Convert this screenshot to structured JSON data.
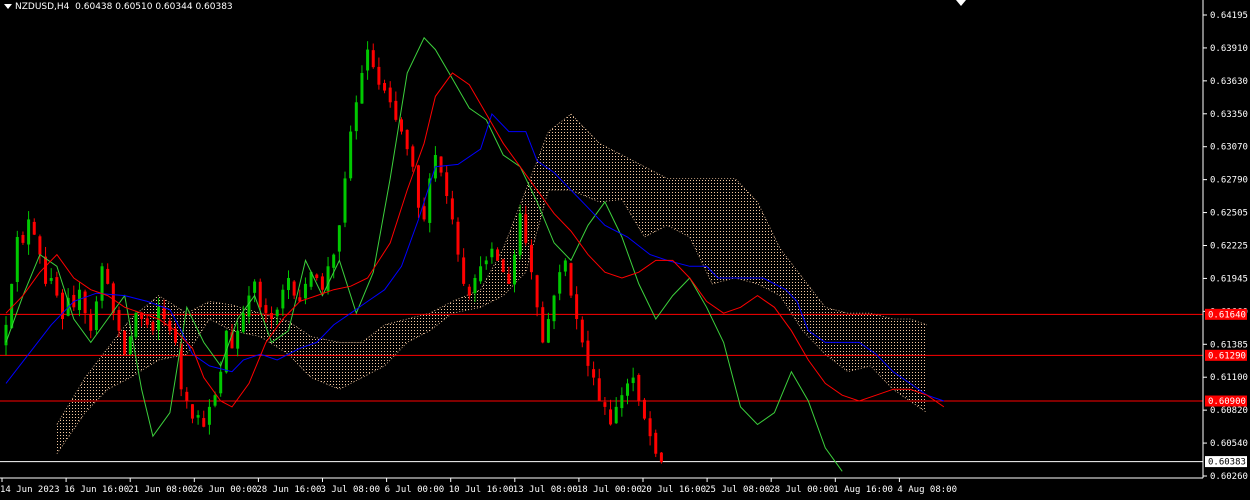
{
  "header": {
    "symbol_tf": "NZDUSD,H4",
    "open": "0.60438",
    "high": "0.60510",
    "low": "0.60344",
    "close": "0.60383"
  },
  "colors": {
    "background": "#000000",
    "bull": "#00c800",
    "bear": "#ff0000",
    "tenkan": "#ff0000",
    "kijun": "#0000ff",
    "chikou": "#3cd03c",
    "cloud": "#f4c8a0",
    "hline": "#ff0000",
    "axis": "#ffffff"
  },
  "chart_data": {
    "type": "candlestick",
    "indicator": "Ichimoku",
    "x_labels": [
      "14 Jun 2023",
      "16 Jun 16:00",
      "21 Jun 08:00",
      "26 Jun 00:00",
      "28 Jun 16:00",
      "3 Jul 08:00",
      "6 Jul 00:00",
      "10 Jul 16:00",
      "13 Jul 08:00",
      "18 Jul 00:00",
      "20 Jul 16:00",
      "25 Jul 08:00",
      "28 Jul 00:00",
      "1 Aug 16:00",
      "4 Aug 08:00"
    ],
    "y_ticks": [
      "0.64195",
      "0.63910",
      "0.63630",
      "0.63350",
      "0.63070",
      "0.62790",
      "0.62505",
      "0.62225",
      "0.61945",
      "0.61660",
      "0.61385",
      "0.61100",
      "0.60820",
      "0.60540",
      "0.60260"
    ],
    "ylim": [
      0.6026,
      0.64195
    ],
    "price_lines": [
      {
        "value": 0.6164,
        "label": "0.61640"
      },
      {
        "value": 0.6129,
        "label": "0.61290"
      },
      {
        "value": 0.609,
        "label": "0.60900"
      }
    ],
    "current_price": {
      "value": 0.60383,
      "label": "0.60383"
    },
    "close_path": [
      [
        0.6155,
        0.619,
        0.623,
        0.6225,
        0.6245,
        0.6232,
        0.6215,
        0.619
      ],
      [
        0.6195,
        0.618,
        0.616,
        0.6178,
        0.617,
        0.6185,
        0.6165,
        0.615
      ],
      [
        0.6175,
        0.6205,
        0.619,
        0.6165,
        0.615,
        0.613,
        0.6145,
        0.6165
      ],
      [
        0.616,
        0.6155,
        0.615,
        0.617,
        0.616,
        0.615,
        0.614,
        0.61
      ],
      [
        0.609,
        0.6075,
        0.6078,
        0.6068,
        0.6085,
        0.6095,
        0.6115,
        0.615
      ],
      [
        0.6135,
        0.615,
        0.6165,
        0.618,
        0.6192,
        0.617,
        0.6165,
        0.616
      ],
      [
        0.6168,
        0.6185,
        0.6195,
        0.618,
        0.6175,
        0.619,
        0.62,
        0.6195
      ],
      [
        0.6185,
        0.6205,
        0.6215,
        0.624,
        0.628,
        0.632,
        0.6345,
        0.637
      ],
      [
        0.639,
        0.6375,
        0.636,
        0.6355,
        0.6345,
        0.633,
        0.632,
        0.6305
      ],
      [
        0.629,
        0.6255,
        0.6245,
        0.628,
        0.63,
        0.6285,
        0.6265,
        0.6245
      ],
      [
        0.6215,
        0.619,
        0.618,
        0.6195,
        0.6205,
        0.621,
        0.622,
        0.621
      ],
      [
        0.62,
        0.619,
        0.6215,
        0.625,
        0.6225,
        0.62,
        0.617,
        0.614
      ],
      [
        0.616,
        0.618,
        0.62,
        0.621,
        0.618,
        0.616,
        0.614,
        0.612
      ],
      [
        0.611,
        0.609,
        0.6085,
        0.607,
        0.6085,
        0.6095,
        0.6105,
        0.611
      ],
      [
        0.609,
        0.6075,
        0.606,
        0.6045,
        0.6038
      ]
    ],
    "tenkan": [
      [
        0,
        0.6165
      ],
      [
        3,
        0.618
      ],
      [
        6,
        0.62
      ],
      [
        9,
        0.6215
      ],
      [
        12,
        0.6195
      ],
      [
        15,
        0.6185
      ],
      [
        18,
        0.618
      ],
      [
        21,
        0.617
      ],
      [
        24,
        0.6165
      ],
      [
        27,
        0.616
      ],
      [
        30,
        0.615
      ],
      [
        33,
        0.6135
      ],
      [
        35,
        0.611
      ],
      [
        38,
        0.609
      ],
      [
        40,
        0.6085
      ],
      [
        43,
        0.6105
      ],
      [
        46,
        0.614
      ],
      [
        49,
        0.616
      ],
      [
        52,
        0.6175
      ],
      [
        55,
        0.618
      ],
      [
        58,
        0.6185
      ],
      [
        61,
        0.6188
      ],
      [
        64,
        0.6195
      ],
      [
        68,
        0.6225
      ],
      [
        71,
        0.627
      ],
      [
        74,
        0.631
      ],
      [
        76,
        0.635
      ],
      [
        79,
        0.637
      ],
      [
        82,
        0.636
      ],
      [
        85,
        0.6335
      ],
      [
        88,
        0.631
      ],
      [
        91,
        0.629
      ],
      [
        94,
        0.627
      ],
      [
        97,
        0.625
      ],
      [
        100,
        0.6235
      ],
      [
        103,
        0.6215
      ],
      [
        106,
        0.62
      ],
      [
        109,
        0.6195
      ],
      [
        112,
        0.62
      ],
      [
        115,
        0.621
      ],
      [
        118,
        0.621
      ],
      [
        121,
        0.6195
      ],
      [
        124,
        0.6175
      ],
      [
        127,
        0.6165
      ],
      [
        130,
        0.617
      ],
      [
        133,
        0.618
      ],
      [
        136,
        0.617
      ],
      [
        139,
        0.615
      ],
      [
        142,
        0.6125
      ],
      [
        145,
        0.6105
      ],
      [
        148,
        0.6095
      ],
      [
        151,
        0.609
      ],
      [
        154,
        0.6095
      ],
      [
        157,
        0.61
      ],
      [
        160,
        0.61
      ],
      [
        163,
        0.6095
      ],
      [
        166,
        0.6085
      ]
    ],
    "kijun": [
      [
        0,
        0.6105
      ],
      [
        4,
        0.613
      ],
      [
        8,
        0.6155
      ],
      [
        12,
        0.6175
      ],
      [
        16,
        0.6182
      ],
      [
        21,
        0.618
      ],
      [
        25,
        0.6175
      ],
      [
        29,
        0.6168
      ],
      [
        31,
        0.615
      ],
      [
        33,
        0.613
      ],
      [
        36,
        0.612
      ],
      [
        40,
        0.6115
      ],
      [
        42,
        0.6125
      ],
      [
        45,
        0.613
      ],
      [
        48,
        0.6125
      ],
      [
        52,
        0.6135
      ],
      [
        55,
        0.614
      ],
      [
        58,
        0.6155
      ],
      [
        61,
        0.6165
      ],
      [
        64,
        0.6175
      ],
      [
        67,
        0.6185
      ],
      [
        70,
        0.6205
      ],
      [
        73,
        0.6245
      ],
      [
        76,
        0.629
      ],
      [
        80,
        0.6292
      ],
      [
        84,
        0.6305
      ],
      [
        86,
        0.6335
      ],
      [
        89,
        0.632
      ],
      [
        92,
        0.632
      ],
      [
        94,
        0.6295
      ],
      [
        97,
        0.6285
      ],
      [
        100,
        0.627
      ],
      [
        103,
        0.6255
      ],
      [
        106,
        0.624
      ],
      [
        110,
        0.623
      ],
      [
        114,
        0.6215
      ],
      [
        117,
        0.621
      ],
      [
        121,
        0.6205
      ],
      [
        124,
        0.6205
      ],
      [
        126,
        0.6195
      ],
      [
        130,
        0.6195
      ],
      [
        134,
        0.6195
      ],
      [
        138,
        0.6185
      ],
      [
        140,
        0.6175
      ],
      [
        142,
        0.615
      ],
      [
        145,
        0.614
      ],
      [
        148,
        0.614
      ],
      [
        151,
        0.614
      ],
      [
        154,
        0.613
      ],
      [
        157,
        0.6115
      ],
      [
        160,
        0.6105
      ],
      [
        163,
        0.6095
      ],
      [
        166,
        0.609
      ]
    ],
    "chikou": [
      [
        0,
        0.614
      ],
      [
        3,
        0.618
      ],
      [
        6,
        0.6215
      ],
      [
        9,
        0.6205
      ],
      [
        12,
        0.616
      ],
      [
        15,
        0.614
      ],
      [
        18,
        0.616
      ],
      [
        21,
        0.618
      ],
      [
        24,
        0.61
      ],
      [
        26,
        0.606
      ],
      [
        29,
        0.608
      ],
      [
        32,
        0.617
      ],
      [
        35,
        0.614
      ],
      [
        38,
        0.612
      ],
      [
        41,
        0.616
      ],
      [
        44,
        0.618
      ],
      [
        47,
        0.614
      ],
      [
        50,
        0.615
      ],
      [
        53,
        0.621
      ],
      [
        56,
        0.618
      ],
      [
        59,
        0.621
      ],
      [
        62,
        0.6165
      ],
      [
        65,
        0.62
      ],
      [
        68,
        0.628
      ],
      [
        71,
        0.637
      ],
      [
        74,
        0.64
      ],
      [
        76,
        0.639
      ],
      [
        79,
        0.6365
      ],
      [
        82,
        0.634
      ],
      [
        85,
        0.633
      ],
      [
        88,
        0.63
      ],
      [
        91,
        0.629
      ],
      [
        94,
        0.626
      ],
      [
        97,
        0.6225
      ],
      [
        100,
        0.621
      ],
      [
        103,
        0.624
      ],
      [
        106,
        0.626
      ],
      [
        109,
        0.623
      ],
      [
        112,
        0.619
      ],
      [
        115,
        0.616
      ],
      [
        118,
        0.618
      ],
      [
        121,
        0.6195
      ],
      [
        124,
        0.617
      ],
      [
        127,
        0.614
      ],
      [
        130,
        0.6085
      ],
      [
        133,
        0.607
      ],
      [
        136,
        0.608
      ],
      [
        139,
        0.6115
      ],
      [
        142,
        0.609
      ],
      [
        145,
        0.605
      ],
      [
        148,
        0.603
      ]
    ],
    "cloud": [
      [
        9,
        0.6045,
        0.607
      ],
      [
        14,
        0.608,
        0.611
      ],
      [
        18,
        0.61,
        0.6135
      ],
      [
        22,
        0.611,
        0.616
      ],
      [
        27,
        0.6125,
        0.618
      ],
      [
        32,
        0.613,
        0.6165
      ],
      [
        36,
        0.616,
        0.6175
      ],
      [
        40,
        0.615,
        0.6172
      ],
      [
        45,
        0.6145,
        0.6165
      ],
      [
        50,
        0.613,
        0.6158
      ],
      [
        54,
        0.611,
        0.6145
      ],
      [
        59,
        0.61,
        0.614
      ],
      [
        63,
        0.611,
        0.614
      ],
      [
        67,
        0.612,
        0.6155
      ],
      [
        71,
        0.614,
        0.616
      ],
      [
        75,
        0.615,
        0.6165
      ],
      [
        79,
        0.6165,
        0.6175
      ],
      [
        84,
        0.617,
        0.6185
      ],
      [
        88,
        0.618,
        0.622
      ],
      [
        92,
        0.62,
        0.627
      ],
      [
        96,
        0.627,
        0.632
      ],
      [
        100,
        0.627,
        0.6335
      ],
      [
        105,
        0.626,
        0.631
      ],
      [
        109,
        0.6262,
        0.63
      ],
      [
        113,
        0.623,
        0.629
      ],
      [
        117,
        0.624,
        0.628
      ],
      [
        121,
        0.623,
        0.628
      ],
      [
        125,
        0.619,
        0.628
      ],
      [
        129,
        0.6195,
        0.628
      ],
      [
        133,
        0.619,
        0.626
      ],
      [
        137,
        0.618,
        0.622
      ],
      [
        141,
        0.615,
        0.6195
      ],
      [
        145,
        0.613,
        0.617
      ],
      [
        149,
        0.6115,
        0.6165
      ],
      [
        153,
        0.612,
        0.6165
      ],
      [
        157,
        0.61,
        0.616
      ],
      [
        160,
        0.609,
        0.616
      ],
      [
        163,
        0.608,
        0.6155
      ]
    ]
  }
}
